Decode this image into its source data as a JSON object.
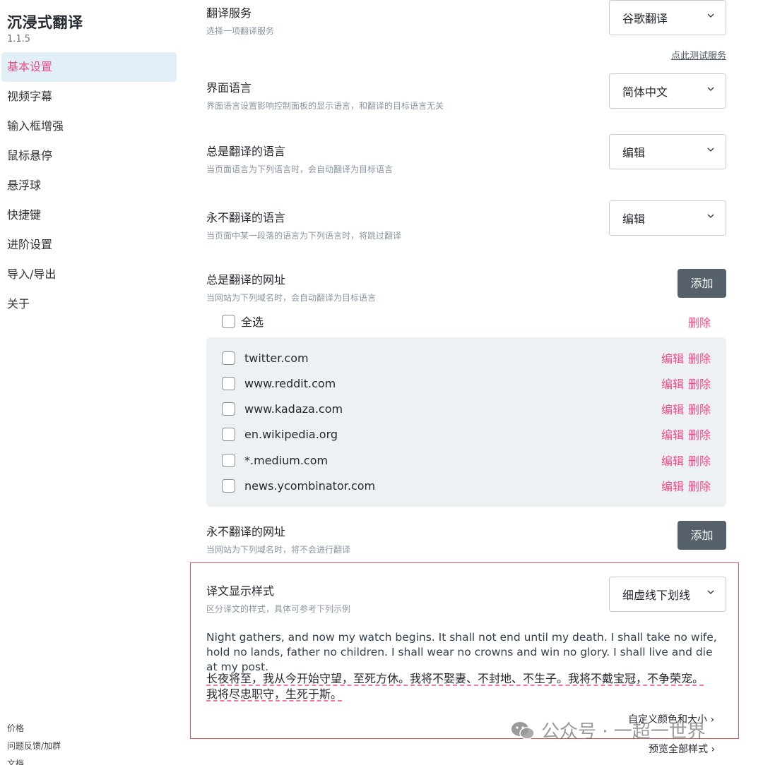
{
  "sidebar": {
    "title": "沉浸式翻译",
    "version": "1.1.5",
    "items": [
      {
        "label": "基本设置",
        "active": true
      },
      {
        "label": "视频字幕"
      },
      {
        "label": "输入框增强"
      },
      {
        "label": "鼠标悬停"
      },
      {
        "label": "悬浮球"
      },
      {
        "label": "快捷键"
      },
      {
        "label": "进阶设置"
      },
      {
        "label": "导入/导出"
      },
      {
        "label": "关于"
      }
    ],
    "footer": [
      "价格",
      "问题反馈/加群",
      "文档"
    ]
  },
  "settings": {
    "service": {
      "label": "翻译服务",
      "desc": "选择一项翻译服务",
      "value": "谷歌翻译",
      "test_link": "点此测试服务"
    },
    "ui_language": {
      "label": "界面语言",
      "desc": "界面语言设置影响控制面板的显示语言，和翻译的目标语言无关",
      "value": "简体中文"
    },
    "always_languages": {
      "label": "总是翻译的语言",
      "desc": "当页面语言为下列语言时，会自动翻译为目标语言",
      "value": "编辑"
    },
    "never_languages": {
      "label": "永不翻译的语言",
      "desc": "当页面中某一段落的语言为下列语言时，将跳过翻译",
      "value": "编辑"
    },
    "always_urls": {
      "label": "总是翻译的网址",
      "desc": "当网站为下列域名时，会自动翻译为目标语言",
      "add": "添加",
      "select_all": "全选",
      "delete": "删除",
      "edit": "编辑",
      "urls": [
        "twitter.com",
        "www.reddit.com",
        "www.kadaza.com",
        "en.wikipedia.org",
        "*.medium.com",
        "news.ycombinator.com"
      ]
    },
    "never_urls": {
      "label": "永不翻译的网址",
      "desc": "当网站为下列域名时，将不会进行翻译",
      "add": "添加"
    },
    "display_style": {
      "label": "译文显示样式",
      "desc": "区分译文的样式，具体可参考下列示例",
      "value": "细虚线下划线",
      "example_en": "Night gathers, and now my watch begins. It shall not end until my death. I shall take no wife, hold no lands, father no children. I shall wear no crowns and win no glory. I shall live and die at my post.",
      "example_zh": "长夜将至，我从今开始守望，至死方休。我将不娶妻、不封地、不生子。我将不戴宝冠，不争荣宠。我将尽忠职守，生死于斯。",
      "custom_link": "自定义颜色和大小 ›",
      "preview_link": "预览全部样式 ›"
    }
  },
  "watermark": "公众号 · 一超一世界",
  "colors": {
    "accent": "#ea4c89",
    "active_bg": "#e1f0f7",
    "button": "#56606b",
    "highlight_border": "#e05656"
  }
}
